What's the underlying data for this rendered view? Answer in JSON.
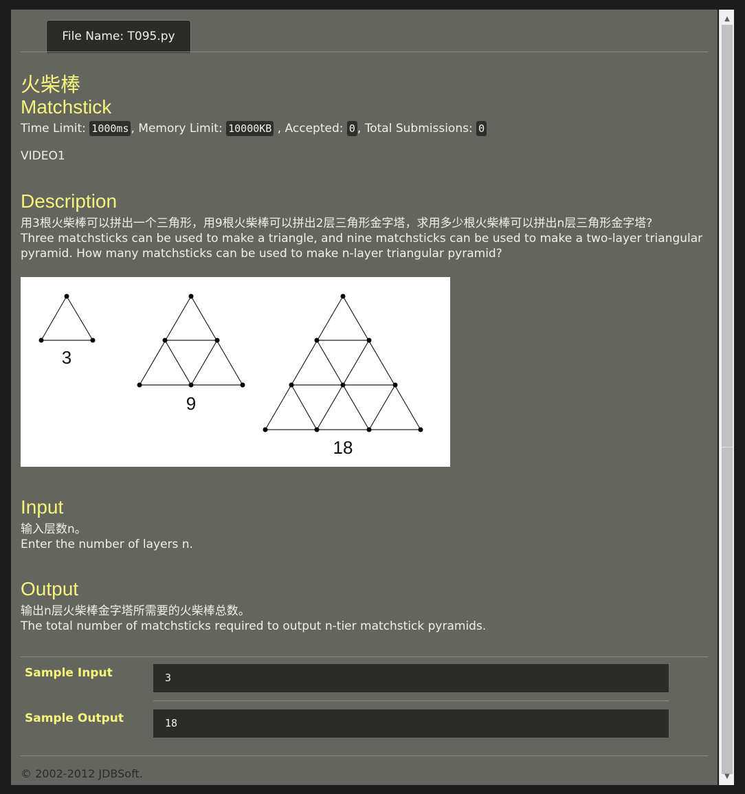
{
  "tab": {
    "label": "File Name:  T095.py"
  },
  "problem": {
    "title_cn": "火柴棒",
    "title_en": "Matchstick",
    "limits": {
      "time_label": "Time Limit:",
      "time_value": "1000ms",
      "memory_label": ", Memory Limit:",
      "memory_value": "10000KB",
      "accepted_label": ", Accepted:",
      "accepted_value": "0",
      "submissions_label": ", Total Submissions:",
      "submissions_value": "0"
    },
    "video": "VIDEO1"
  },
  "description": {
    "heading": "Description",
    "cn": "用3根火柴棒可以拼出一个三角形，用9根火柴棒可以拼出2层三角形金字塔，求用多少根火柴棒可以拼出n层三角形金字塔?",
    "en": "Three matchsticks can be used to make a triangle, and nine matchsticks can be used to make a two-layer triangular pyramid. How many matchsticks can be used to make n-layer triangular pyramid?"
  },
  "figure": {
    "labels": [
      "3",
      "9",
      "18"
    ]
  },
  "input": {
    "heading": "Input",
    "cn": "输入层数n。",
    "en": "Enter the number of layers n."
  },
  "output": {
    "heading": "Output",
    "cn": "输出n层火柴棒金字塔所需要的火柴棒总数。",
    "en": "The total number of matchsticks required to output n-tier matchstick pyramids."
  },
  "samples": {
    "input_label": "Sample Input",
    "input_value": "3",
    "output_label": "Sample Output",
    "output_value": "18"
  },
  "footer": "© 2002-2012  JDBSoft.",
  "colors": {
    "background": "#656560",
    "heading": "#f4f47a",
    "text": "#f0f0e8",
    "code_bg": "#2e2e2c"
  }
}
